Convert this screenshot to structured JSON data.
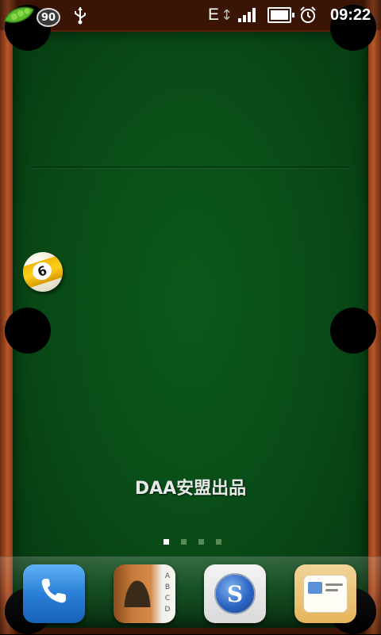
{
  "status_bar": {
    "notification_badge": "90",
    "network_type": "E",
    "time": "09:22",
    "icons": [
      "pea-icon",
      "paw-badge-icon",
      "usb-icon",
      "data-arrows-icon",
      "signal-icon",
      "battery-icon",
      "alarm-icon"
    ]
  },
  "wallpaper": {
    "ball_number": "9",
    "watermark": "DAA安盟出品"
  },
  "page_indicator": {
    "count": 4,
    "active": 0
  },
  "dock": {
    "apps": [
      "phone-icon",
      "contacts-icon",
      "browser-icon",
      "messages-icon"
    ],
    "contacts_tabs": [
      "A",
      "B",
      "C",
      "D"
    ]
  },
  "colors": {
    "felt": "#094a17",
    "rail": "#5a1f08",
    "ball_stripe": "#ffcf20",
    "phone_app": "#2a7fd6"
  }
}
